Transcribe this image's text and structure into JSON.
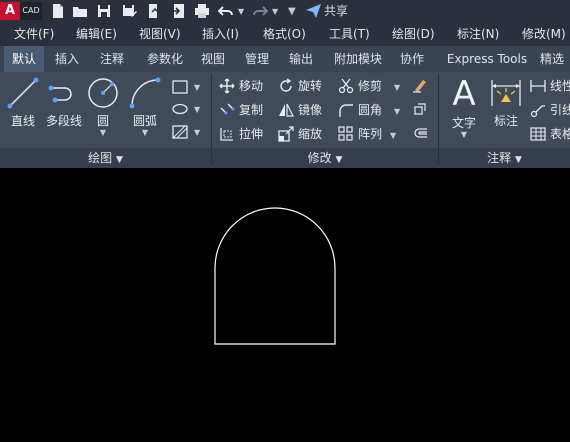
{
  "app": {
    "logo_letter": "A",
    "logo_text": "CAD",
    "share_label": "共享"
  },
  "menu": [
    "文件(F)",
    "编辑(E)",
    "视图(V)",
    "插入(I)",
    "格式(O)",
    "工具(T)",
    "绘图(D)",
    "标注(N)",
    "修改(M)"
  ],
  "tabs": [
    "默认",
    "插入",
    "注释",
    "参数化",
    "视图",
    "管理",
    "输出",
    "附加模块",
    "协作",
    "Express Tools",
    "精选"
  ],
  "draw_panel": {
    "title": "绘图",
    "line": "直线",
    "polyline": "多段线",
    "circle": "圆",
    "arc": "圆弧"
  },
  "modify_panel": {
    "title": "修改",
    "move": "移动",
    "rotate": "旋转",
    "trim": "修剪",
    "copy": "复制",
    "mirror": "镜像",
    "fillet": "圆角",
    "stretch": "拉伸",
    "scale": "缩放",
    "array": "阵列"
  },
  "annotation_panel": {
    "title": "注释",
    "text": "文字",
    "dimension": "标注",
    "linear": "线性",
    "leader": "引线",
    "table": "表格"
  },
  "colors": {
    "accent": "#4a5a70",
    "ribbon": "#404a59",
    "canvas": "#000000",
    "logo": "#c8102e"
  }
}
